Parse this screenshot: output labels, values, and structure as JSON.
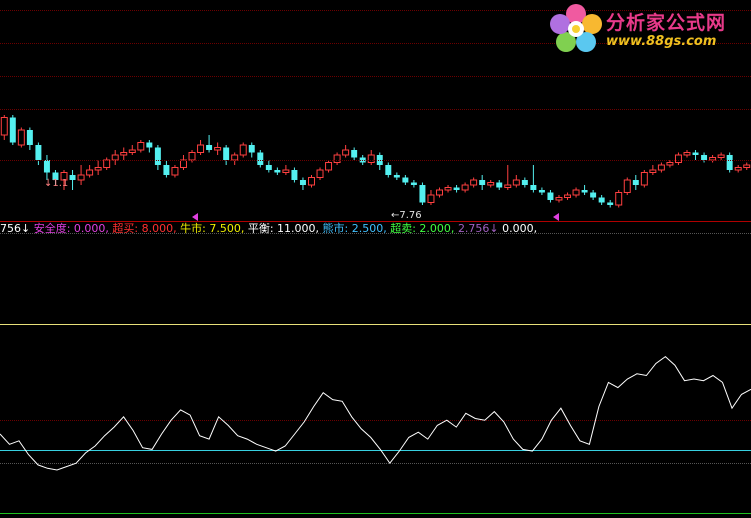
{
  "logo": {
    "title": "分析家公式网",
    "url": "www.88gs.com"
  },
  "legend": {
    "prefix": "756↓",
    "safety": "安全度: 0.000,",
    "overbought": "超买: 8.000,",
    "bull": "牛市: 7.500,",
    "balance": "平衡: 11.000,",
    "bear": "熊市: 2.500,",
    "oversold": "超卖: 2.000,",
    "value": "2.756↓",
    "last": "0.000,"
  },
  "annotations": {
    "low": "←7.76",
    "first": "↓1.1"
  },
  "colors": {
    "up": "#ff4040",
    "down": "#54f0f0",
    "line": "#ffffff",
    "legend_safety": "#e040e0",
    "legend_overbought": "#ff3030",
    "legend_bull": "#f0f000",
    "legend_balance": "#ffffff",
    "legend_bear": "#40c0ff",
    "legend_oversold": "#40ff40",
    "legend_value": "#a060c0",
    "legend_last": "#ffffff"
  },
  "chart_data": [
    {
      "type": "candlestick",
      "title": "",
      "candles": [
        [
          8.2,
          8.55,
          8.6,
          8.1
        ],
        [
          8.55,
          8.05,
          8.6,
          8.0
        ],
        [
          8.0,
          8.3,
          8.35,
          7.95
        ],
        [
          8.3,
          8.0,
          8.35,
          7.9
        ],
        [
          8.0,
          7.7,
          8.05,
          7.6
        ],
        [
          7.7,
          7.45,
          7.8,
          7.3
        ],
        [
          7.45,
          7.3,
          7.5,
          7.2
        ],
        [
          7.3,
          7.45,
          7.5,
          7.1
        ],
        [
          7.4,
          7.3,
          7.5,
          7.1
        ],
        [
          7.3,
          7.4,
          7.6,
          7.2
        ],
        [
          7.4,
          7.5,
          7.6,
          7.35
        ],
        [
          7.5,
          7.55,
          7.7,
          7.4
        ],
        [
          7.55,
          7.7,
          7.75,
          7.5
        ],
        [
          7.7,
          7.8,
          7.9,
          7.6
        ],
        [
          7.8,
          7.85,
          7.95,
          7.7
        ],
        [
          7.85,
          7.9,
          8.0,
          7.8
        ],
        [
          7.9,
          8.05,
          8.1,
          7.85
        ],
        [
          8.05,
          7.95,
          8.1,
          7.85
        ],
        [
          7.95,
          7.6,
          8.0,
          7.5
        ],
        [
          7.6,
          7.4,
          7.7,
          7.35
        ],
        [
          7.4,
          7.55,
          7.6,
          7.35
        ],
        [
          7.55,
          7.7,
          7.8,
          7.5
        ],
        [
          7.7,
          7.85,
          7.9,
          7.65
        ],
        [
          7.85,
          8.0,
          8.1,
          7.8
        ],
        [
          8.0,
          7.9,
          8.2,
          7.85
        ],
        [
          7.9,
          7.95,
          8.05,
          7.8
        ],
        [
          7.95,
          7.7,
          8.0,
          7.6
        ],
        [
          7.7,
          7.8,
          7.85,
          7.6
        ],
        [
          7.8,
          8.0,
          8.05,
          7.75
        ],
        [
          8.0,
          7.85,
          8.05,
          7.75
        ],
        [
          7.85,
          7.6,
          7.9,
          7.55
        ],
        [
          7.6,
          7.5,
          7.7,
          7.45
        ],
        [
          7.5,
          7.45,
          7.55,
          7.4
        ],
        [
          7.45,
          7.5,
          7.6,
          7.4
        ],
        [
          7.5,
          7.3,
          7.55,
          7.25
        ],
        [
          7.3,
          7.2,
          7.35,
          7.1
        ],
        [
          7.2,
          7.35,
          7.4,
          7.15
        ],
        [
          7.35,
          7.5,
          7.55,
          7.3
        ],
        [
          7.5,
          7.65,
          7.7,
          7.45
        ],
        [
          7.65,
          7.8,
          7.85,
          7.6
        ],
        [
          7.8,
          7.9,
          8.0,
          7.75
        ],
        [
          7.9,
          7.75,
          7.95,
          7.7
        ],
        [
          7.75,
          7.65,
          7.8,
          7.6
        ],
        [
          7.65,
          7.8,
          7.9,
          7.6
        ],
        [
          7.8,
          7.6,
          7.85,
          7.5
        ],
        [
          7.6,
          7.4,
          7.65,
          7.35
        ],
        [
          7.4,
          7.35,
          7.45,
          7.3
        ],
        [
          7.35,
          7.25,
          7.4,
          7.2
        ],
        [
          7.25,
          7.2,
          7.3,
          7.15
        ],
        [
          7.2,
          6.85,
          7.25,
          6.8
        ],
        [
          6.85,
          7.0,
          7.1,
          6.8
        ],
        [
          7.0,
          7.1,
          7.15,
          6.95
        ],
        [
          7.1,
          7.15,
          7.2,
          7.05
        ],
        [
          7.15,
          7.1,
          7.2,
          7.05
        ],
        [
          7.1,
          7.2,
          7.25,
          7.05
        ],
        [
          7.2,
          7.3,
          7.35,
          7.15
        ],
        [
          7.3,
          7.2,
          7.4,
          7.1
        ],
        [
          7.2,
          7.25,
          7.3,
          7.15
        ],
        [
          7.25,
          7.15,
          7.3,
          7.1
        ],
        [
          7.15,
          7.2,
          7.6,
          7.1
        ],
        [
          7.2,
          7.3,
          7.4,
          7.15
        ],
        [
          7.3,
          7.2,
          7.35,
          7.15
        ],
        [
          7.2,
          7.1,
          7.6,
          7.05
        ],
        [
          7.1,
          7.05,
          7.15,
          7.0
        ],
        [
          7.05,
          6.9,
          7.1,
          6.85
        ],
        [
          6.9,
          6.95,
          7.0,
          6.85
        ],
        [
          6.95,
          7.0,
          7.05,
          6.9
        ],
        [
          7.0,
          7.1,
          7.15,
          6.95
        ],
        [
          7.1,
          7.05,
          7.2,
          7.0
        ],
        [
          7.05,
          6.95,
          7.1,
          6.9
        ],
        [
          6.95,
          6.85,
          7.0,
          6.8
        ],
        [
          6.85,
          6.8,
          6.9,
          6.75
        ],
        [
          6.8,
          7.05,
          7.1,
          6.75
        ],
        [
          7.05,
          7.3,
          7.35,
          7.0
        ],
        [
          7.3,
          7.2,
          7.4,
          7.1
        ],
        [
          7.2,
          7.45,
          7.5,
          7.15
        ],
        [
          7.45,
          7.5,
          7.6,
          7.4
        ],
        [
          7.5,
          7.6,
          7.65,
          7.45
        ],
        [
          7.6,
          7.65,
          7.7,
          7.55
        ],
        [
          7.65,
          7.8,
          7.85,
          7.6
        ],
        [
          7.8,
          7.85,
          7.9,
          7.75
        ],
        [
          7.85,
          7.8,
          7.9,
          7.7
        ],
        [
          7.8,
          7.7,
          7.85,
          7.65
        ],
        [
          7.7,
          7.75,
          7.8,
          7.65
        ],
        [
          7.75,
          7.8,
          7.85,
          7.7
        ],
        [
          7.8,
          7.5,
          7.85,
          7.45
        ],
        [
          7.5,
          7.55,
          7.6,
          7.45
        ],
        [
          7.55,
          7.6,
          7.65,
          7.5
        ]
      ]
    },
    {
      "type": "line",
      "title": "",
      "values": [
        4.6,
        4.0,
        4.2,
        3.4,
        2.8,
        2.6,
        2.5,
        2.7,
        2.9,
        3.5,
        3.9,
        4.5,
        5.0,
        5.6,
        4.8,
        3.8,
        3.7,
        4.6,
        5.4,
        6.0,
        5.7,
        4.5,
        4.3,
        5.6,
        5.1,
        4.5,
        4.3,
        4.0,
        3.8,
        3.6,
        3.9,
        4.6,
        5.3,
        6.2,
        7.0,
        6.6,
        6.5,
        5.6,
        4.9,
        4.4,
        3.7,
        2.9,
        3.6,
        4.4,
        4.7,
        4.3,
        5.1,
        5.4,
        5.0,
        5.8,
        5.5,
        5.4,
        5.9,
        5.3,
        4.3,
        3.7,
        3.6,
        4.3,
        5.4,
        6.1,
        5.1,
        4.2,
        4.0,
        6.2,
        7.6,
        7.3,
        7.8,
        8.1,
        8.0,
        8.7,
        9.1,
        8.6,
        7.7,
        7.8,
        7.7,
        8.0,
        7.6,
        6.1,
        6.9,
        7.2
      ],
      "ylim": [
        0,
        11
      ]
    }
  ]
}
